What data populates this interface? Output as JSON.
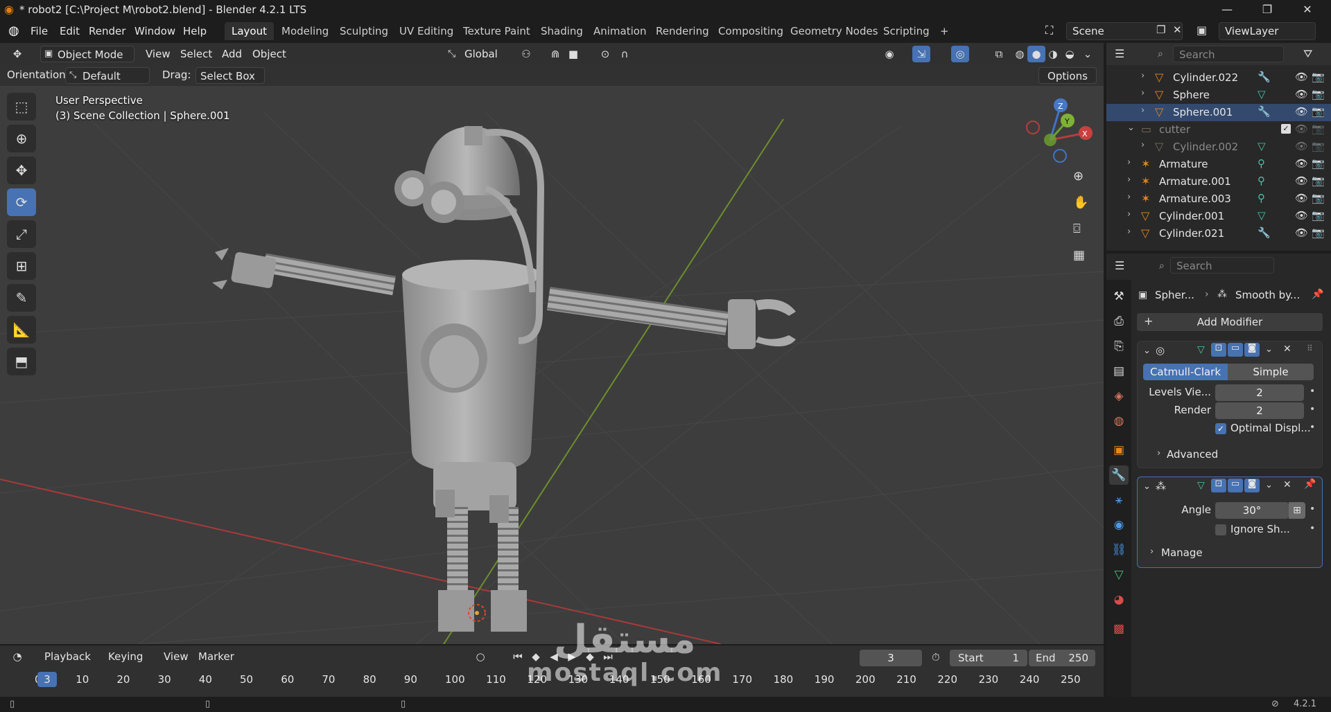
{
  "window": {
    "title": "* robot2 [C:\\Project M\\robot2.blend] - Blender 4.2.1 LTS",
    "minimize": "—",
    "maximize": "❐",
    "close": "✕"
  },
  "menu": [
    "File",
    "Edit",
    "Render",
    "Window",
    "Help"
  ],
  "workspaces": [
    "Layout",
    "Modeling",
    "Sculpting",
    "UV Editing",
    "Texture Paint",
    "Shading",
    "Animation",
    "Rendering",
    "Compositing",
    "Geometry Nodes",
    "Scripting",
    "+"
  ],
  "active_workspace": "Layout",
  "scene": {
    "name": "Scene",
    "view_layer": "ViewLayer"
  },
  "viewport_header": {
    "mode": "Object Mode",
    "menus": [
      "View",
      "Select",
      "Add",
      "Object"
    ],
    "transform_orientation": "Global",
    "options": "Options"
  },
  "tool_settings": {
    "orientation_label": "Orientation:",
    "orientation_value": "Default",
    "drag_label": "Drag:",
    "drag_value": "Select Box"
  },
  "viewport_info": {
    "line1": "User Perspective",
    "line2": "(3) Scene Collection | Sphere.001"
  },
  "gizmo": {
    "x": "X",
    "y": "Y",
    "z": "Z"
  },
  "outliner": {
    "search_placeholder": "Search",
    "rows": [
      {
        "name": "Cylinder.022",
        "icon": "▽",
        "mod": "wrench",
        "level": 1,
        "dim": false
      },
      {
        "name": "Sphere",
        "icon": "▽",
        "mod": "mesh",
        "level": 1,
        "dim": false
      },
      {
        "name": "Sphere.001",
        "icon": "▽",
        "mod": "wrench",
        "level": 1,
        "dim": false
      },
      {
        "name": "cutter",
        "icon": "▭",
        "mod": "",
        "level": 0,
        "dim": true
      },
      {
        "name": "Cylinder.002",
        "icon": "▽",
        "mod": "mesh",
        "level": 1,
        "dim": true
      },
      {
        "name": "Armature",
        "icon": "✶",
        "mod": "armature",
        "level": 0,
        "dim": false
      },
      {
        "name": "Armature.001",
        "icon": "✶",
        "mod": "armature",
        "level": 0,
        "dim": false
      },
      {
        "name": "Armature.003",
        "icon": "✶",
        "mod": "armature",
        "level": 0,
        "dim": false
      },
      {
        "name": "Cylinder.001",
        "icon": "▽",
        "mod": "mesh",
        "level": 0,
        "dim": false
      },
      {
        "name": "Cylinder.021",
        "icon": "▽",
        "mod": "wrench",
        "level": 0,
        "dim": false
      }
    ]
  },
  "properties": {
    "search_placeholder": "Search",
    "breadcrumb_obj": "Spher...",
    "breadcrumb_mod": "Smooth by...",
    "add_modifier": "Add Modifier",
    "subsurf": {
      "mode_a": "Catmull-Clark",
      "mode_b": "Simple",
      "levels_label": "Levels Vie...",
      "levels_value": "2",
      "render_label": "Render",
      "render_value": "2",
      "optimal_label": "Optimal Displ...",
      "advanced": "Advanced"
    },
    "smooth": {
      "angle_label": "Angle",
      "angle_value": "30°",
      "ignore_label": "Ignore Sh...",
      "manage": "Manage"
    }
  },
  "timeline": {
    "menus": [
      "Playback",
      "Keying",
      "View",
      "Marker"
    ],
    "current_frame": "3",
    "start_label": "Start",
    "start_value": "1",
    "end_label": "End",
    "end_value": "250",
    "ruler": [
      "0",
      "10",
      "20",
      "30",
      "40",
      "50",
      "60",
      "70",
      "80",
      "90",
      "100",
      "110",
      "120",
      "130",
      "140",
      "150",
      "160",
      "170",
      "180",
      "190",
      "200",
      "210",
      "220",
      "230",
      "240",
      "250"
    ]
  },
  "status": {
    "version": "4.2.1"
  },
  "watermark": {
    "arabic": "مستقل",
    "latin": "mostaql.com"
  }
}
